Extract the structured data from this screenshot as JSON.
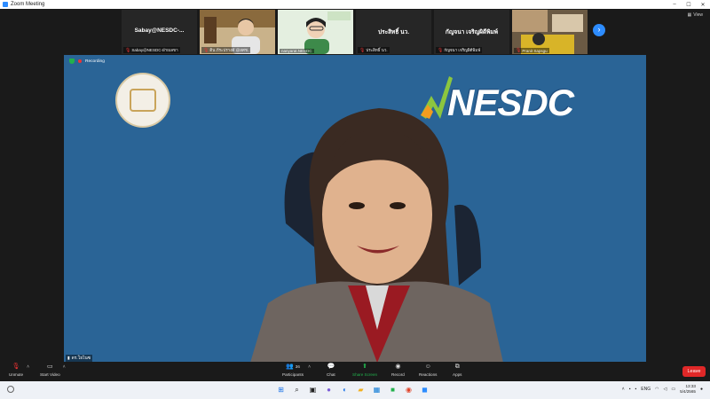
{
  "window": {
    "title": "Zoom Meeting",
    "controls": [
      "–",
      "☐",
      "✕"
    ]
  },
  "gallery": {
    "view_label": "View",
    "tiles": [
      {
        "name": "Sabay@NESDC-...",
        "caption": "Sabay@NESDC-ฝ่ายเลขา",
        "has_video": false
      },
      {
        "name": "",
        "caption": "ดิน ภีระปรางค์ @สศช.",
        "has_video": true
      },
      {
        "name": "",
        "caption": "nanyarat.NESDC",
        "has_video": true
      },
      {
        "name": "ประสิทธิ์ นว.",
        "caption": "ประสิทธิ์ นว.",
        "has_video": false
      },
      {
        "name": "กัญจนา เจริญผิดีพิมพ์",
        "caption": "กัญจนา เจริญผิดีพิมพ์",
        "has_video": false
      },
      {
        "name": "",
        "caption": "Pranit Sapsgu",
        "has_video": true
      }
    ]
  },
  "main": {
    "recording_label": "Recording",
    "logo_text": "NESDC",
    "speaker_label": "ดร.โยไนซ",
    "background_color": "#2a6496"
  },
  "toolbar": {
    "unmute": "Unmute",
    "start_video": "Start Video",
    "participants": "Participants",
    "participants_count": "36",
    "chat": "Chat",
    "share_screen": "Share Screen",
    "record": "Record",
    "reactions": "Reactions",
    "apps": "Apps",
    "leave": "Leave"
  },
  "taskbar": {
    "lang": "ENG",
    "time": "13:33",
    "date": "5/4/2565"
  }
}
